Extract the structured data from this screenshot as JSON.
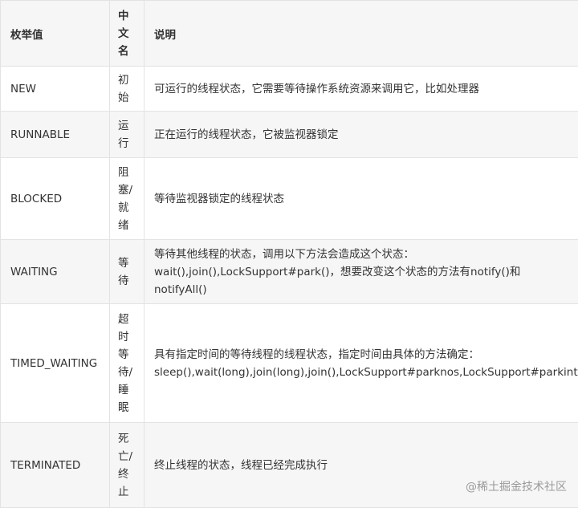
{
  "header": {
    "enum": "枚举值",
    "cn": [
      "中",
      "文",
      "名"
    ],
    "desc": "说明"
  },
  "rows": [
    {
      "enum": "NEW",
      "cn": [
        "初",
        "始"
      ],
      "desc": [
        "可运行的线程状态，它需要等待操作系统资源来调用它，比如处理器"
      ]
    },
    {
      "enum": "RUNNABLE",
      "cn": [
        "运",
        "行"
      ],
      "desc": [
        "正在运行的线程状态，它被监视器锁定"
      ]
    },
    {
      "enum": "BLOCKED",
      "cn": [
        "阻",
        "塞/",
        "就",
        "绪"
      ],
      "desc": [
        "等待监视器锁定的线程状态"
      ]
    },
    {
      "enum": "WAITING",
      "cn": [
        "等",
        "待"
      ],
      "desc": [
        "等待其他线程的状态，调用以下方法会造成这个状态：",
        "wait(),join(),LockSupport#park()，想要改变这个状态的方法有notify()和",
        "notifyAll()"
      ]
    },
    {
      "enum": "TIMED_WAITING",
      "cn": [
        "超",
        "时",
        "等",
        "待/",
        "睡",
        "眠"
      ],
      "desc": [
        "具有指定时间的等待线程的线程状态，指定时间由具体的方法确定：",
        "sleep(),wait(long),join(long),join(),LockSupport#parknos,LockSupport#parkintil"
      ]
    },
    {
      "enum": "TERMINATED",
      "cn": [
        "死",
        "亡/",
        "终",
        "止"
      ],
      "desc": [
        "终止线程的状态，线程已经完成执行"
      ]
    }
  ],
  "watermark": "@稀土掘金技术社区"
}
